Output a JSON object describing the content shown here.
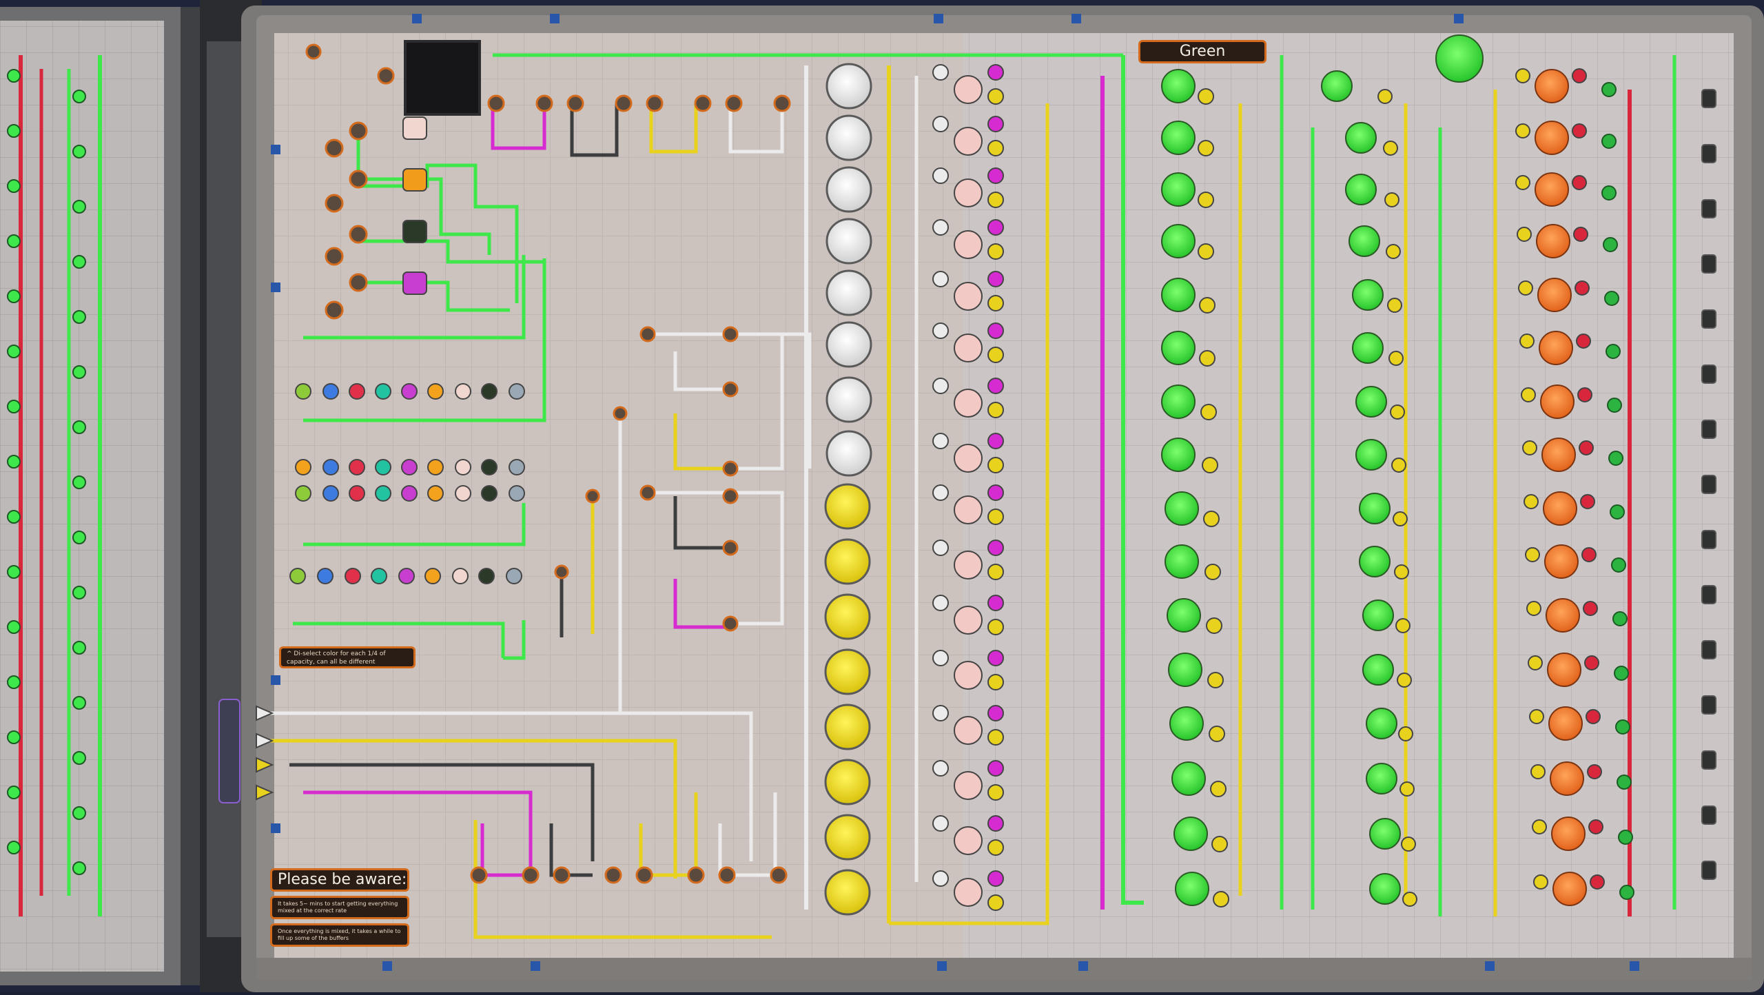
{
  "signs": {
    "green": "Green",
    "capacity_note": "^ Di-select color for each 1/4 of capacity, can all be different",
    "please_aware": "Please be aware:",
    "note_1": "It takes 5~ mins to start getting everything mixed at the correct rate",
    "note_2": "Once everything is mixed, it takes a while to fill up some of the buffers"
  },
  "colors": {
    "floor": "#cbc7c6",
    "green": "#3ee84a",
    "yellow": "#e8d21e",
    "magenta": "#d62bd0",
    "red": "#d8263c",
    "white": "#ecebeb",
    "dark": "#3b3d3f",
    "orange": "#f0782a",
    "sign_border": "#d46a1c"
  },
  "icons": [
    "pump-icon",
    "valve-icon",
    "tank-icon",
    "mixer-icon",
    "pipe-icon"
  ]
}
